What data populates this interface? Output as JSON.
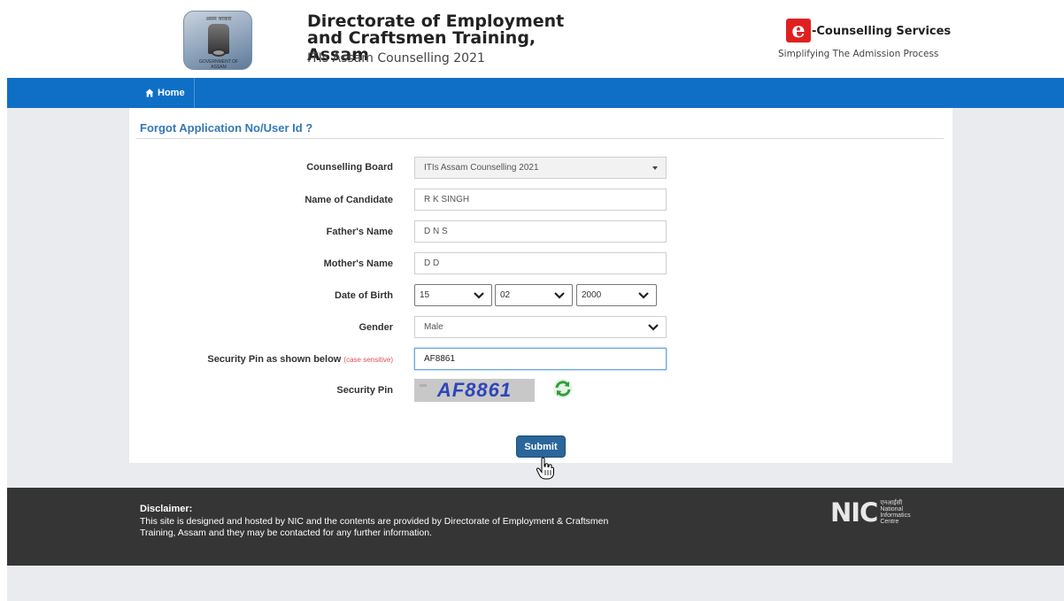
{
  "header": {
    "emblem_top_text": "असम चरकार",
    "emblem_bottom_text": "GOVERNMENT OF ASSAM",
    "org_title": "Directorate of Employment and Craftsmen Training, Assam",
    "org_subtitle": "ITIs Assam Counselling 2021",
    "ec_logo_letter": "e",
    "ec_title": "-Counselling Services",
    "ec_tagline": "Simplifying The Admission Process"
  },
  "nav": {
    "home_label": "Home",
    "home_icon": "home-icon"
  },
  "form": {
    "title": "Forgot Application No/User Id ?",
    "counselling_board": {
      "label": "Counselling Board",
      "value": "ITIs Assam Counselling 2021"
    },
    "candidate_name": {
      "label": "Name of Candidate",
      "value": "R K SINGH"
    },
    "father_name": {
      "label": "Father's Name",
      "value": "D N S"
    },
    "mother_name": {
      "label": "Mother's Name",
      "value": "D D"
    },
    "dob": {
      "label": "Date of Birth",
      "day": "15",
      "month": "02",
      "year": "2000"
    },
    "gender": {
      "label": "Gender",
      "value": "Male"
    },
    "security_pin_input": {
      "label": "Security Pin as shown below",
      "note": "(case sensitive)",
      "value": "AF8861"
    },
    "security_pin": {
      "label": "Security Pin",
      "captcha_text": "AF8861",
      "refresh_icon": "refresh-icon"
    },
    "submit_label": "Submit"
  },
  "footer": {
    "disclaimer_title": "Disclaimer:",
    "disclaimer_text": "This site is designed and hosted by NIC and the contents are provided by Directorate of Employment & Craftsmen Training, Assam and they may be contacted for any further information.",
    "nic_mark": "NIC",
    "nic_hindi": "एनआईसी",
    "nic_text": "National Informatics Centre"
  },
  "colors": {
    "nav_blue": "#0f6fc6",
    "title_blue": "#3478b8",
    "submit_blue": "#2a6699",
    "footer_dark": "#353535",
    "page_bg": "#e9ebee",
    "accent_red": "#e02020"
  }
}
